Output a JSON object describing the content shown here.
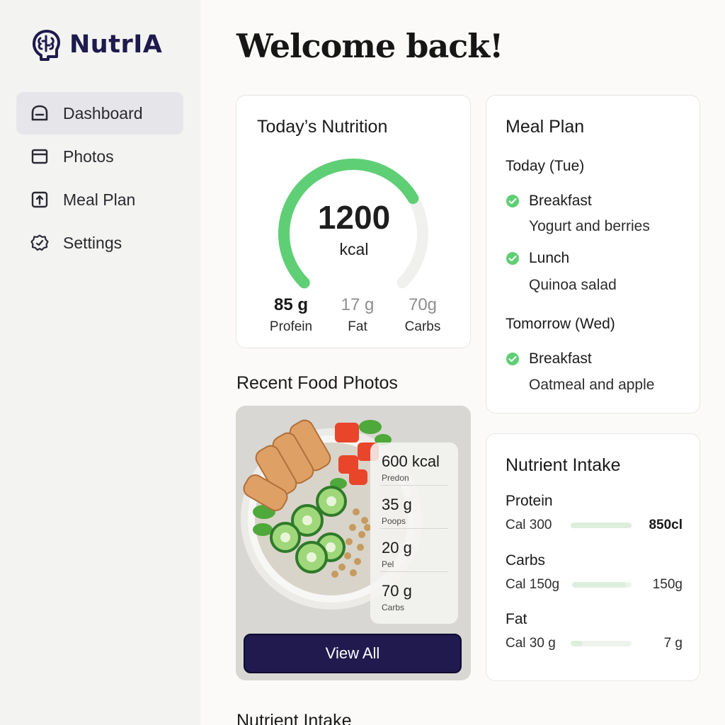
{
  "app": {
    "name": "NutrIA"
  },
  "sidebar": {
    "items": [
      {
        "label": "Dashboard",
        "icon": "dashboard-icon",
        "active": true
      },
      {
        "label": "Photos",
        "icon": "photos-icon",
        "active": false
      },
      {
        "label": "Meal Plan",
        "icon": "meal-plan-icon",
        "active": false
      },
      {
        "label": "Settings",
        "icon": "settings-icon",
        "active": false
      }
    ]
  },
  "main": {
    "title": "Welcome back!"
  },
  "nutrition": {
    "title": "Today’s Nutrition",
    "calories": "1200",
    "calories_unit": "kcal",
    "gauge_fraction": 0.72,
    "macros": [
      {
        "value": "85 g",
        "label": "Profein"
      },
      {
        "value": "17 g",
        "label": "Fat"
      },
      {
        "value": "70g",
        "label": "Carbs"
      }
    ]
  },
  "recent_photos": {
    "title": "Recent Food Photos",
    "overlay": [
      {
        "value": "600 kcal",
        "label": "Predon"
      },
      {
        "value": "35 g",
        "label": "Poops"
      },
      {
        "value": "20 g",
        "label": "Pel"
      },
      {
        "value": "70 g",
        "label": "Carbs"
      }
    ],
    "view_all_label": "View All"
  },
  "meal_plan": {
    "title": "Meal Plan",
    "days": [
      {
        "day": "Today (Tue)",
        "meals": [
          {
            "name": "Breakfast",
            "desc": "Yogurt and berries"
          },
          {
            "name": "Lunch",
            "desc": "Quinoa salad"
          }
        ]
      },
      {
        "day": "Tomorrow (Wed)",
        "meals": [
          {
            "name": "Breakfast",
            "desc": "Oatmeal and apple"
          }
        ]
      }
    ]
  },
  "nutrient_intake": {
    "title": "Nutrient Intake",
    "items": [
      {
        "name": "Protein",
        "left": "Cal 300",
        "right": "850cl",
        "fraction": 1.0
      },
      {
        "name": "Carbs",
        "left": "Cal 150g",
        "right": "150g",
        "fraction": 0.9
      },
      {
        "name": "Fat",
        "left": "Cal 30 g",
        "right": "7 g",
        "fraction": 0.2
      }
    ]
  },
  "footer_section": {
    "title": "Nutrient Intake"
  },
  "colors": {
    "accent": "#201a4f",
    "green": "#5fcf75",
    "track": "#f0f0ee"
  }
}
